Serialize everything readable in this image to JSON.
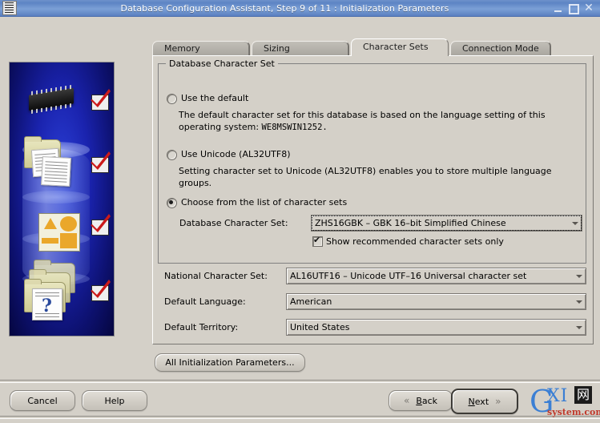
{
  "window": {
    "title": "Database Configuration Assistant, Step 9 of 11 : Initialization Parameters",
    "icon": "app-icon",
    "minimize_label": "",
    "maximize_label": "",
    "close_label": "✕"
  },
  "tabs": [
    {
      "label": "Memory",
      "active": false
    },
    {
      "label": "Sizing",
      "active": false
    },
    {
      "label": "Character Sets",
      "active": true
    },
    {
      "label": "Connection Mode",
      "active": false
    }
  ],
  "groupbox": {
    "title": "Database Character Set",
    "options": [
      {
        "label": "Use the default",
        "selected": false,
        "description_line1": "The default character set for this database is based on the language setting of this",
        "description_line2_prefix": "operating system: ",
        "description_line2_value": "WE8MSWIN1252."
      },
      {
        "label": "Use Unicode (AL32UTF8)",
        "selected": false,
        "description_line1": "Setting character set to Unicode (AL32UTF8) enables you to store multiple language",
        "description_line2_prefix": "groups.",
        "description_line2_value": ""
      },
      {
        "label": "Choose from the list of character sets",
        "selected": true
      }
    ],
    "db_charset_label": "Database Character Set:",
    "db_charset_value": "ZHS16GBK – GBK 16–bit Simplified Chinese",
    "show_recommended_label": "Show recommended character sets only",
    "show_recommended_checked": true
  },
  "fields": [
    {
      "label": "National Character Set:",
      "value": "AL16UTF16 – Unicode UTF–16 Universal character set"
    },
    {
      "label": "Default Language:",
      "value": "American"
    },
    {
      "label": "Default Territory:",
      "value": "United States"
    }
  ],
  "all_params_button": "All Initialization Parameters...",
  "footer": {
    "cancel": "Cancel",
    "help": "Help",
    "back": "Back",
    "back_accel": "B",
    "next": "Next",
    "next_accel": "N",
    "back_chevron": "«",
    "next_chevron": "»"
  },
  "watermark": {
    "letter_g": "G",
    "letters_xi": "XI",
    "cn_char": "网",
    "subtitle": "system.com"
  },
  "colors": {
    "titlebar": "#5d84c4",
    "window_bg": "#d4d0c8",
    "banner_blue": "#1a23ae",
    "check_red": "#cc1a1a",
    "accent_orange": "#eaa72a"
  }
}
